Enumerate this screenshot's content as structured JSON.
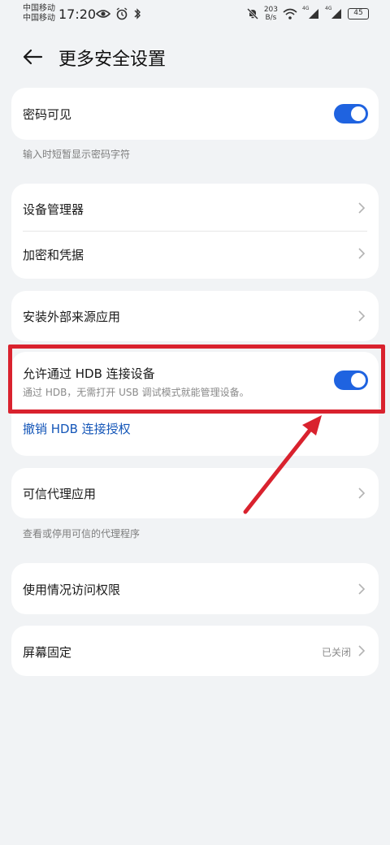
{
  "status_bar": {
    "carrier_1": "中国移动",
    "carrier_2": "中国移动",
    "time": "17:20",
    "net_speed_value": "203",
    "net_speed_unit": "B/s",
    "signal_1_label": "4G",
    "signal_2_label": "4G",
    "battery": "45"
  },
  "header": {
    "title": "更多安全设置"
  },
  "password_card": {
    "label": "密码可见",
    "toggle_on": true,
    "hint": "输入时短暂显示密码字符"
  },
  "device_card": {
    "items": [
      {
        "label": "设备管理器"
      },
      {
        "label": "加密和凭据"
      }
    ]
  },
  "external_card": {
    "label": "安装外部来源应用"
  },
  "hdb_card": {
    "label": "允许通过 HDB 连接设备",
    "sublabel": "通过 HDB，无需打开 USB 调试模式就能管理设备。",
    "toggle_on": true,
    "revoke_link": "撤销 HDB 连接授权"
  },
  "trust_card": {
    "label": "可信代理应用",
    "hint": "查看或停用可信的代理程序"
  },
  "usage_card": {
    "label": "使用情况访问权限"
  },
  "pin_card": {
    "label": "屏幕固定",
    "value": "已关闭"
  },
  "colors": {
    "accent": "#1f63e0",
    "link": "#1456b8",
    "annotation_red": "#d9222e",
    "background": "#f1f3f5"
  }
}
